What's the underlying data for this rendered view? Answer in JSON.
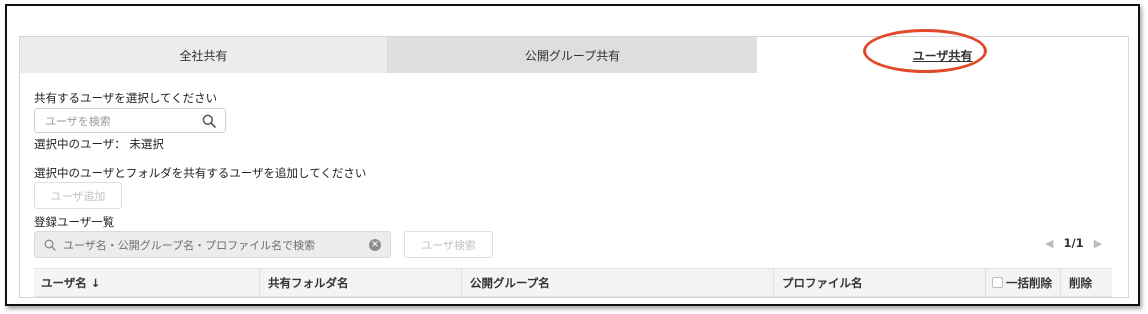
{
  "tabs": [
    {
      "label": "全社共有"
    },
    {
      "label": "公開グループ共有"
    },
    {
      "label": "ユーザ共有"
    }
  ],
  "select_user": {
    "prompt": "共有するユーザを選択してください",
    "search_placeholder": "ユーザを検索",
    "selected_text": "選択中のユーザ： 未選択"
  },
  "add_user": {
    "prompt": "選択中のユーザとフォルダを共有するユーザを追加してください",
    "button_label": "ユーザ追加"
  },
  "registered": {
    "title": "登録ユーザ一覧",
    "filter_placeholder": "ユーザ名・公開グループ名・プロファイル名で検索",
    "search_button": "ユーザ検索",
    "pagination": "1/1"
  },
  "table": {
    "columns": [
      "ユーザ名 ↓",
      "共有フォルダ名",
      "公開グループ名",
      "プロファイル名",
      "一括削除",
      "削除"
    ]
  },
  "colors": {
    "highlight_oval": "#e04a2a",
    "inactive_tab": "#dedede"
  }
}
